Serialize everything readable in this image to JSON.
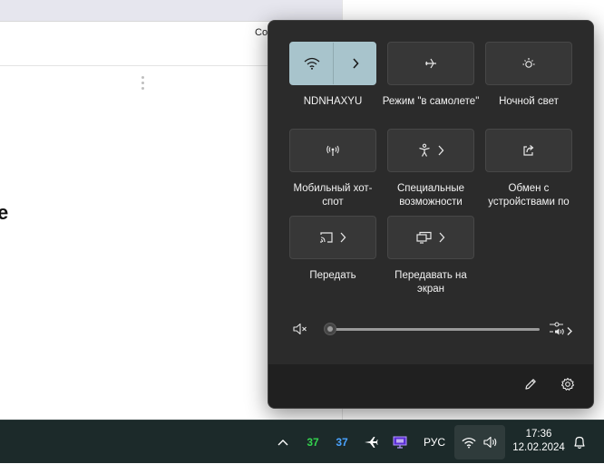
{
  "background": {
    "partial_text": "Co",
    "partial_heading": "e"
  },
  "quick_settings": {
    "tiles": [
      {
        "label": "NDNHAXYU",
        "icon": "wifi-icon",
        "has_chevron": true,
        "active": true
      },
      {
        "label": "Режим \"в самолете\"",
        "icon": "airplane-icon",
        "has_chevron": false,
        "active": false
      },
      {
        "label": "Ночной свет",
        "icon": "night-light-icon",
        "has_chevron": false,
        "active": false
      },
      {
        "label": "Мобильный хот-спот",
        "icon": "hotspot-icon",
        "has_chevron": false,
        "active": false
      },
      {
        "label": "Специальные возможности",
        "icon": "accessibility-icon",
        "has_chevron": true,
        "active": false
      },
      {
        "label": "Обмен с устройствами по",
        "icon": "share-icon",
        "has_chevron": false,
        "active": false
      },
      {
        "label": "Передать",
        "icon": "cast-icon",
        "has_chevron": true,
        "active": false
      },
      {
        "label": "Передавать на экран",
        "icon": "project-icon",
        "has_chevron": true,
        "active": false
      }
    ],
    "volume": {
      "level": 0,
      "muted": true,
      "icon": "speaker-muted-icon"
    },
    "footer": {
      "edit_icon": "pencil-icon",
      "settings_icon": "gear-icon"
    }
  },
  "taskbar": {
    "overflow_icon": "chevron-up-icon",
    "temp1": "37",
    "temp2": "37",
    "language": "РУС",
    "time": "17:36",
    "date": "12.02.2024",
    "notification_icon": "bell-icon"
  },
  "colors": {
    "panel_bg": "#2b2b2b",
    "tile_bg": "#373737",
    "tile_active": "#a8c4cc",
    "taskbar_bg": "#1c2a2a",
    "temp_green": "#34d34e",
    "temp_blue": "#4aa3ff"
  }
}
